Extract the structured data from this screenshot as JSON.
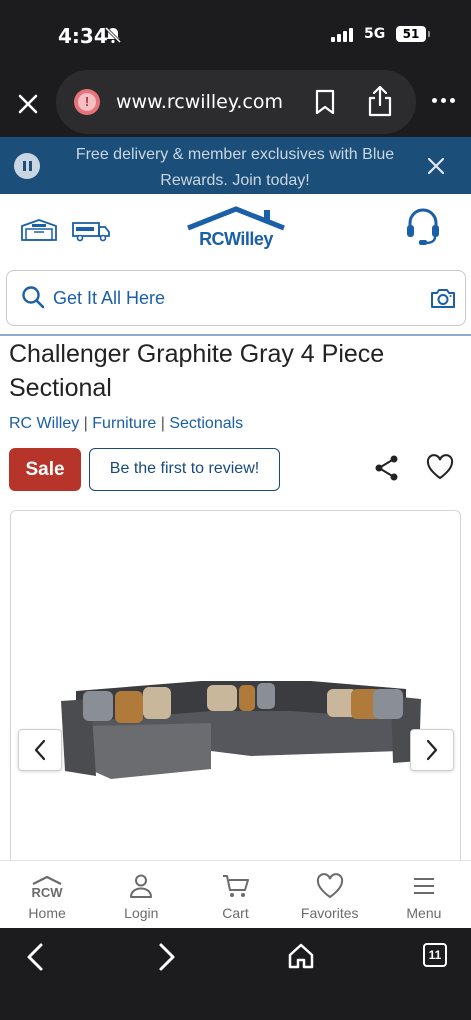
{
  "status_bar": {
    "time": "4:34",
    "network": "5G",
    "battery": "51"
  },
  "browser": {
    "url": "www.rcwilley.com",
    "tab_count": "11"
  },
  "promo": {
    "text": "Free delivery & member exclusives with Blue Rewards. Join today!"
  },
  "header": {
    "logo_text": "RCWilley"
  },
  "search": {
    "placeholder": "Get It All Here"
  },
  "product": {
    "title": "Challenger Graphite Gray 4 Piece Sectional",
    "breadcrumbs": [
      "RC Willey",
      "Furniture",
      "Sectionals"
    ],
    "sale_label": "Sale",
    "review_label": "Be the first to review!"
  },
  "bottom_nav": {
    "items": [
      {
        "label": "Home",
        "icon": "rcw-home-icon",
        "icon_text": "RCW"
      },
      {
        "label": "Login",
        "icon": "person-icon"
      },
      {
        "label": "Cart",
        "icon": "cart-icon"
      },
      {
        "label": "Favorites",
        "icon": "heart-icon"
      },
      {
        "label": "Menu",
        "icon": "hamburger-icon"
      }
    ]
  },
  "colors": {
    "brand_blue": "#1a5fa8",
    "sale_red": "#b7342a",
    "promo_bg": "#1b4f7a"
  }
}
